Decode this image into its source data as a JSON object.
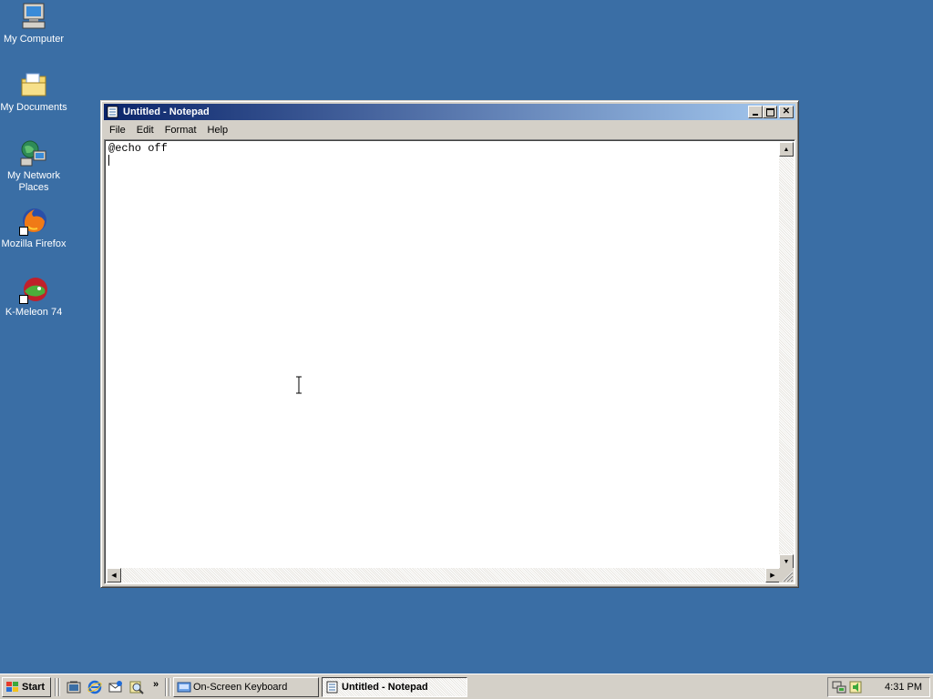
{
  "desktop": {
    "background_color": "#3a6ea5",
    "icons": [
      {
        "label": "My Computer",
        "icon": "my-computer-icon"
      },
      {
        "label": "My Documents",
        "icon": "my-documents-icon"
      },
      {
        "label": "My Network Places",
        "icon": "network-places-icon"
      },
      {
        "label": "Mozilla Firefox",
        "icon": "firefox-icon"
      },
      {
        "label": "K-Meleon 74",
        "icon": "k-meleon-icon"
      }
    ]
  },
  "window": {
    "title": "Untitled - Notepad",
    "menu": [
      "File",
      "Edit",
      "Format",
      "Help"
    ],
    "content_line1": "@echo off",
    "titlebar_colors": [
      "#0a246a",
      "#a6caf0"
    ]
  },
  "taskbar": {
    "start_label": "Start",
    "quick_launch": [
      "show-desktop-icon",
      "internet-explorer-icon",
      "outlook-express-icon",
      "search-icon"
    ],
    "more_label": "»",
    "tasks": [
      {
        "label": "On-Screen Keyboard",
        "active": false
      },
      {
        "label": "Untitled - Notepad",
        "active": true
      }
    ],
    "clock": "4:31 PM"
  }
}
